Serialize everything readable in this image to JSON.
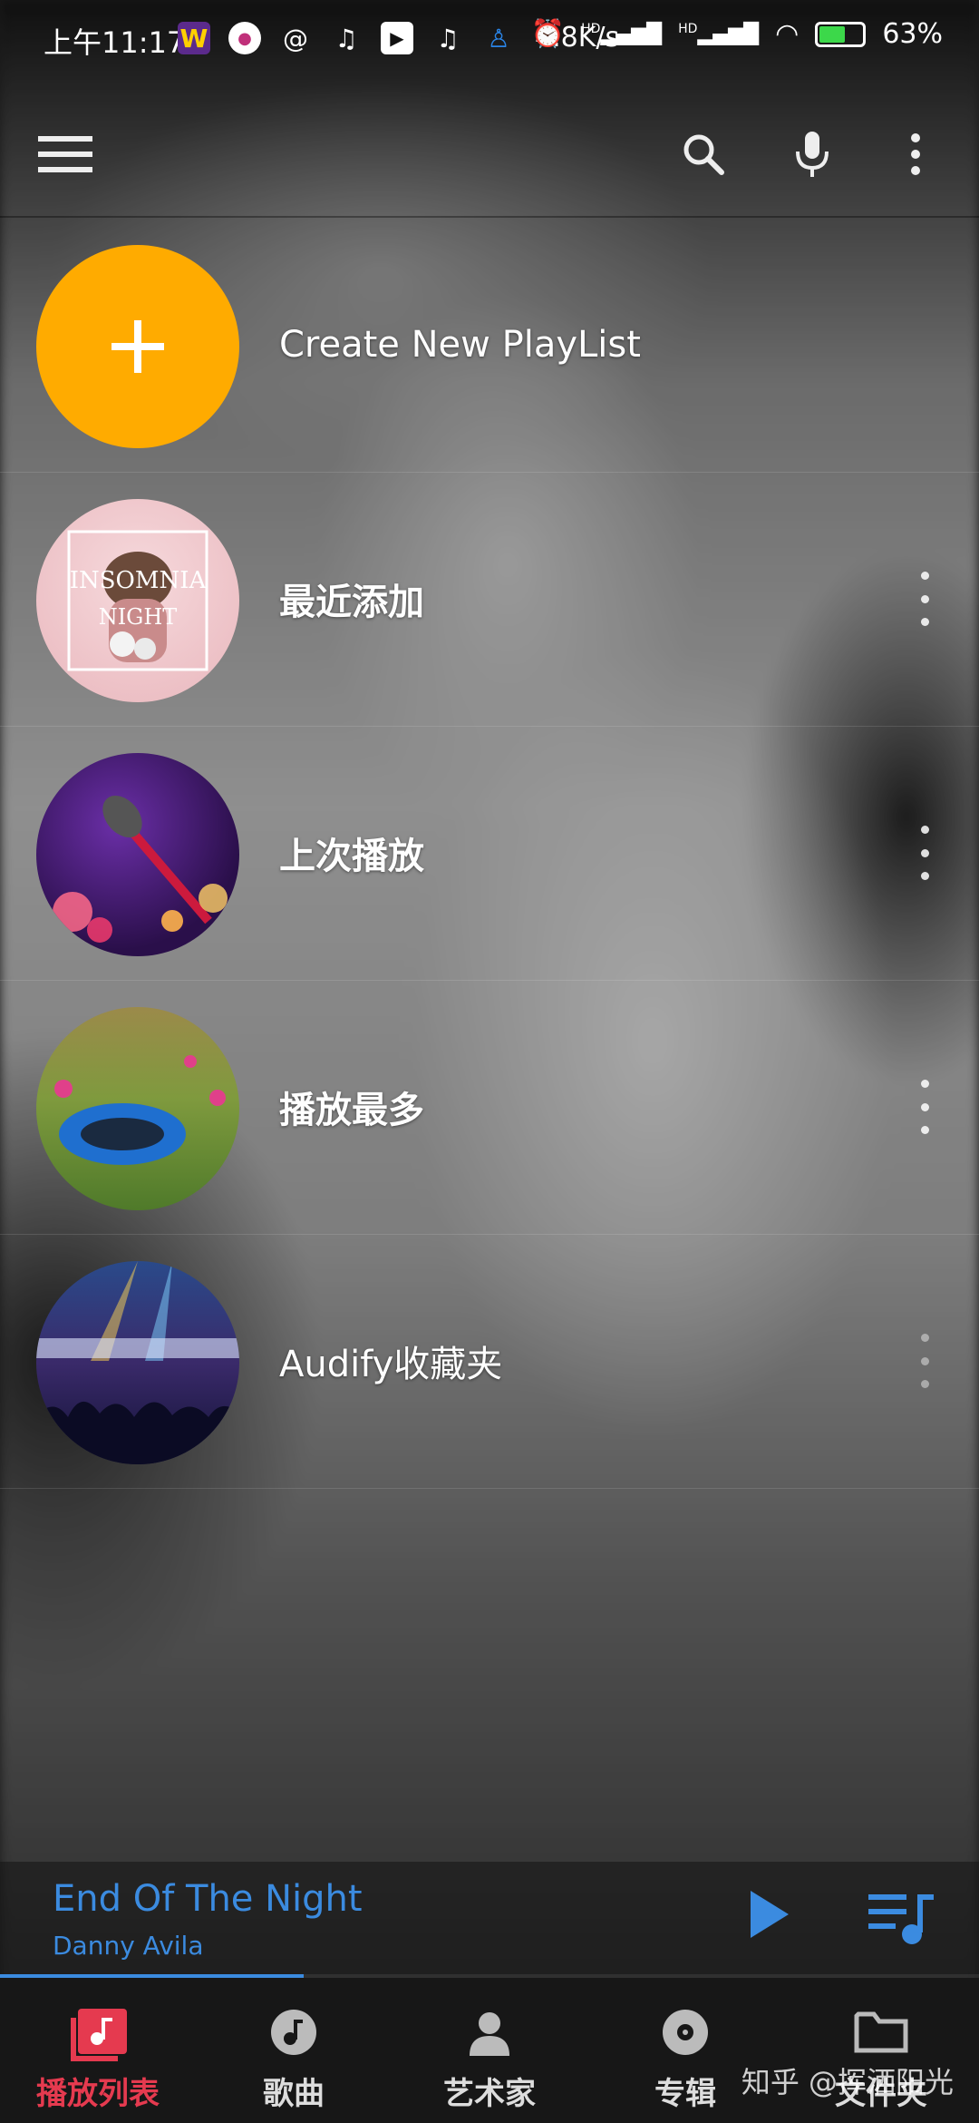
{
  "status_bar": {
    "time": "上午11:17",
    "network_speed": "4.8K/s",
    "battery_percent": "63%",
    "battery_level": 0.63,
    "app_icons": [
      "weibo-icon",
      "lips-icon",
      "at-icon",
      "music-note-icon",
      "play-app-icon",
      "music-note-icon",
      "qq-icon"
    ],
    "hd_labels": [
      "HD",
      "HD"
    ]
  },
  "toolbar": {
    "icons": [
      "menu-icon",
      "search-icon",
      "mic-icon",
      "more-vert-icon"
    ]
  },
  "playlists": {
    "create_label": "Create New PlayList",
    "items": [
      {
        "label": "最近添加"
      },
      {
        "label": "上次播放"
      },
      {
        "label": "播放最多"
      },
      {
        "label": "Audify收藏夹"
      }
    ]
  },
  "thumbnail_text": {
    "line1": "INSOMNIA",
    "line2": "NIGHT"
  },
  "now_playing": {
    "title": "End Of The Night",
    "artist": "Danny Avila",
    "progress": 0.31
  },
  "bottom_nav": {
    "tabs": [
      {
        "label": "播放列表",
        "icon": "playlist-icon",
        "active": true
      },
      {
        "label": "歌曲",
        "icon": "song-icon",
        "active": false
      },
      {
        "label": "艺术家",
        "icon": "artist-icon",
        "active": false
      },
      {
        "label": "专辑",
        "icon": "album-icon",
        "active": false
      },
      {
        "label": "文件夹",
        "icon": "folder-icon",
        "active": false
      }
    ]
  },
  "watermark": "知乎 @挥洒阳光",
  "colors": {
    "accent_blue": "#3b8be0",
    "active_red": "#e53a4f",
    "fab_orange": "#ffab00"
  }
}
